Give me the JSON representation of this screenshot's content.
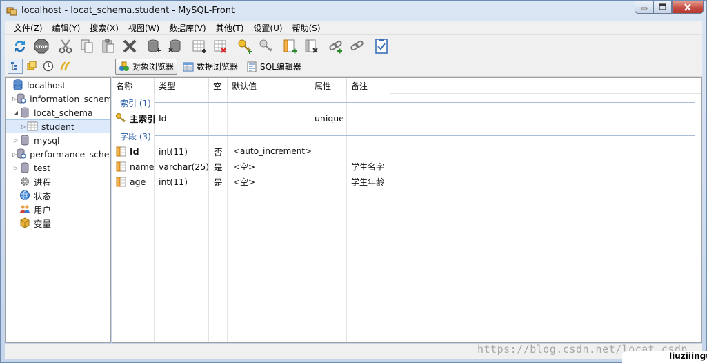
{
  "window": {
    "title": "localhost - locat_schema.student - MySQL-Front",
    "controls": [
      "minimize",
      "maximize",
      "close"
    ]
  },
  "menubar": {
    "items": [
      "文件(Z)",
      "编辑(Y)",
      "搜索(X)",
      "视图(W)",
      "数据库(V)",
      "其他(T)",
      "设置(U)",
      "帮助(S)"
    ]
  },
  "toolbar": {
    "icons": [
      "refresh-icon",
      "stop-icon",
      "cut-icon",
      "copy-icon",
      "paste-icon",
      "delete-icon",
      "database-add-icon",
      "database-delete-icon",
      "table-add-icon",
      "table-delete-icon",
      "key-add-icon",
      "key-delete-icon",
      "field-add-icon",
      "field-delete-icon",
      "link-add-icon",
      "link-delete-icon",
      "properties-icon"
    ]
  },
  "viewbar": {
    "left_icons": [
      "tree-view-icon",
      "bookmark-icon",
      "history-icon",
      "favorites-icon"
    ],
    "tabs": [
      {
        "label": "对象浏览器",
        "icon": "object-browser-icon",
        "active": true
      },
      {
        "label": "数据浏览器",
        "icon": "data-browser-icon",
        "active": false
      },
      {
        "label": "SQL编辑器",
        "icon": "sql-editor-icon",
        "active": false
      }
    ]
  },
  "tree": {
    "items": [
      {
        "label": "localhost",
        "icon": "server-icon",
        "level": 0,
        "expander": ""
      },
      {
        "label": "information_schem",
        "icon": "system-database-icon",
        "level": 1,
        "expander": "collapsed"
      },
      {
        "label": "locat_schema",
        "icon": "database-icon",
        "level": 1,
        "expander": "expanded"
      },
      {
        "label": "student",
        "icon": "table-icon",
        "level": 2,
        "expander": "collapsed",
        "selected": true
      },
      {
        "label": "mysql",
        "icon": "database-icon",
        "level": 1,
        "expander": "collapsed"
      },
      {
        "label": "performance_scher",
        "icon": "system-database-icon",
        "level": 1,
        "expander": "collapsed"
      },
      {
        "label": "test",
        "icon": "database-icon",
        "level": 1,
        "expander": "collapsed"
      },
      {
        "label": "进程",
        "icon": "process-icon",
        "level": 1,
        "expander": ""
      },
      {
        "label": "状态",
        "icon": "status-icon",
        "level": 1,
        "expander": ""
      },
      {
        "label": "用户",
        "icon": "users-icon",
        "level": 1,
        "expander": ""
      },
      {
        "label": "变量",
        "icon": "variables-icon",
        "level": 1,
        "expander": ""
      }
    ]
  },
  "grid": {
    "columns": [
      "名称",
      "类型",
      "空",
      "默认值",
      "属性",
      "备注"
    ],
    "groups": [
      {
        "label": "索引 (1)",
        "rows": [
          {
            "icon": "key-icon",
            "name": "主索引",
            "type": "Id",
            "null": "",
            "default": "",
            "attr": "unique",
            "comment": "",
            "bold": true
          }
        ]
      },
      {
        "label": "字段 (3)",
        "rows": [
          {
            "icon": "field-icon",
            "name": "Id",
            "type": "int(11)",
            "null": "否",
            "default": "<auto_increment>",
            "attr": "",
            "comment": "",
            "bold": true
          },
          {
            "icon": "field-icon",
            "name": "name",
            "type": "varchar(25)",
            "null": "是",
            "default": "<空>",
            "attr": "",
            "comment": "学生名字",
            "bold": false
          },
          {
            "icon": "field-icon",
            "name": "age",
            "type": "int(11)",
            "null": "是",
            "default": "<空>",
            "attr": "",
            "comment": "学生年龄",
            "bold": false
          }
        ]
      }
    ]
  },
  "watermark": {
    "url": "https://blog.csdn.net/locat_csdn",
    "badge": "liuziiingu"
  }
}
